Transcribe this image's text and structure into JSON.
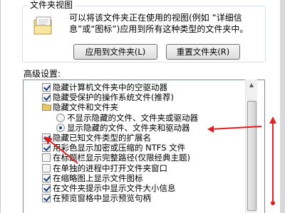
{
  "folder_views": {
    "title": "文件夹视图",
    "description": "可以将该文件夹正在使用的视图(例如 “详细信息”或“图标”)应用到所有这种类型的文件夹中。",
    "apply_button": "应用到文件夹(L)",
    "reset_button": "重置文件夹(R)"
  },
  "advanced": {
    "label": "高级设置:",
    "items": [
      {
        "type": "checkbox",
        "checked": true,
        "indent": 0,
        "label": "隐藏计算机文件夹中的空驱动器"
      },
      {
        "type": "checkbox",
        "checked": true,
        "indent": 0,
        "label": "隐藏受保护的操作系统文件(推荐)"
      },
      {
        "type": "folder",
        "checked": false,
        "indent": 0,
        "label": "隐藏文件和文件夹"
      },
      {
        "type": "radio",
        "checked": false,
        "indent": 1,
        "label": "不显示隐藏的文件、文件夹或驱动器"
      },
      {
        "type": "radio",
        "checked": true,
        "indent": 1,
        "label": "显示隐藏的文件、文件夹和驱动器"
      },
      {
        "type": "checkbox",
        "checked": true,
        "indent": 0,
        "label": "隐藏已知文件类型的扩展名"
      },
      {
        "type": "checkbox",
        "checked": true,
        "indent": 0,
        "label": "用彩色显示加密或压缩的 NTFS 文件"
      },
      {
        "type": "checkbox",
        "checked": false,
        "indent": 0,
        "label": "在标题栏显示完整路径(仅限经典主题)"
      },
      {
        "type": "checkbox",
        "checked": false,
        "indent": 0,
        "label": "在单独的进程中打开文件夹窗口"
      },
      {
        "type": "checkbox",
        "checked": true,
        "indent": 0,
        "label": "在缩略图上显示文件图标"
      },
      {
        "type": "checkbox",
        "checked": true,
        "indent": 0,
        "label": "在文件夹提示中显示文件大小信息"
      },
      {
        "type": "checkbox",
        "checked": true,
        "indent": 0,
        "label": "在预览窗格中显示预览句柄"
      }
    ]
  },
  "colors": {
    "annotation": "#e02020",
    "check": "#1a3e82"
  }
}
